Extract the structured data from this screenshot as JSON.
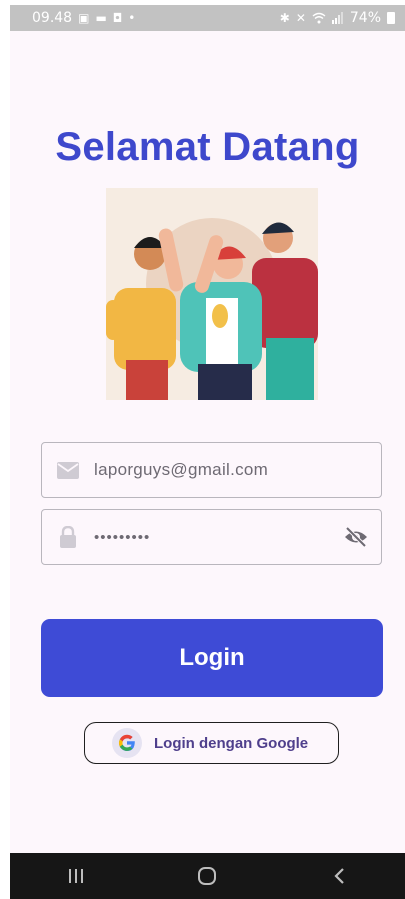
{
  "status_bar": {
    "time": "09.48",
    "battery": "74%"
  },
  "title": "Selamat Datang",
  "form": {
    "email_value": "laporguys@gmail.com",
    "password_value": "•••••••••"
  },
  "buttons": {
    "login_label": "Login",
    "google_label": "Login dengan Google"
  },
  "icons": {
    "email": "mail-icon",
    "password": "lock-icon",
    "visibility": "eye-off-icon",
    "google": "google-logo-icon"
  },
  "colors": {
    "accent": "#3e48cc",
    "button": "#3e4bd6",
    "background": "#fdf7fc"
  }
}
